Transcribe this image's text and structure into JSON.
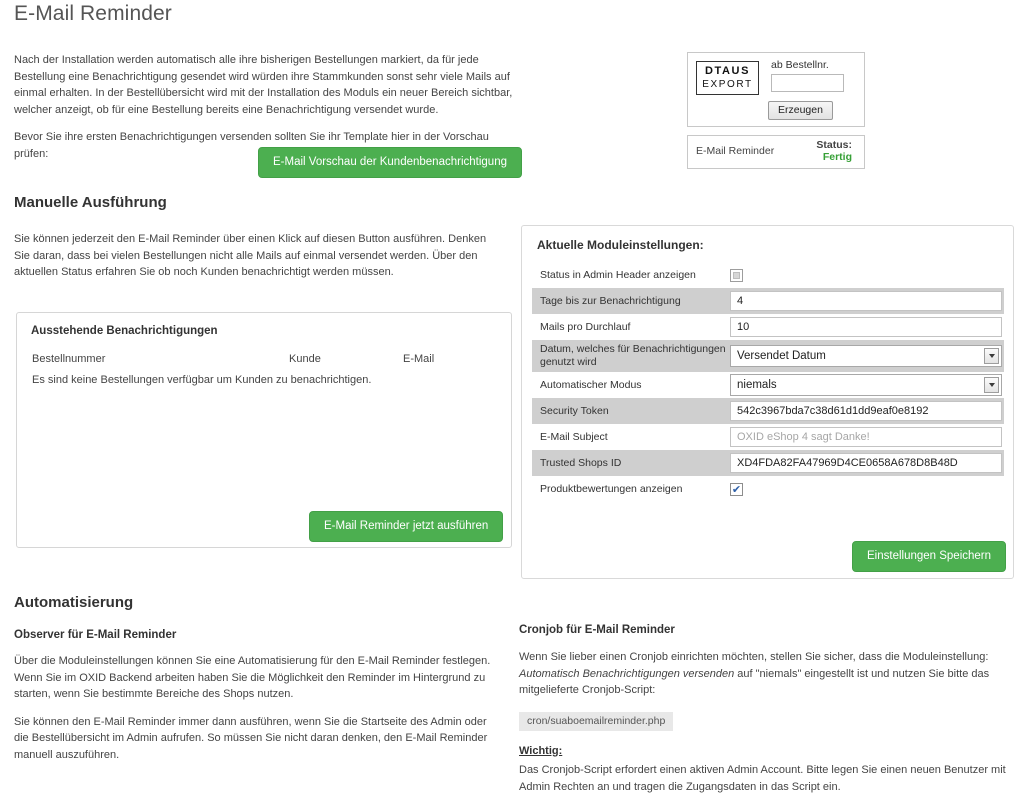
{
  "page": {
    "title": "E-Mail Reminder"
  },
  "intro": {
    "paragraph1": "Nach der Installation werden automatisch alle ihre bisherigen Bestellungen markiert, da für jede Bestellung eine Benachrichtigung gesendet wird würden ihre Stammkunden sonst sehr viele Mails auf einmal erhalten. In der Bestellübersicht wird mit der Installation des Moduls ein neuer Bereich sichtbar, welcher anzeigt, ob für eine Bestellung bereits eine Benachrichtigung versendet wurde.",
    "paragraph2": "Bevor Sie ihre ersten Benachrichtigungen versenden sollten Sie ihr Template hier in der Vorschau prüfen:",
    "preview_button": "E-Mail Vorschau der Kundenbenachrichtigung"
  },
  "dtaus": {
    "logo_line1": "DTAUS",
    "logo_line2": "EXPORT",
    "field_label": "ab Bestellnr.",
    "field_value": "",
    "field_placeholder": "",
    "generate_button": "Erzeugen"
  },
  "status_card": {
    "name": "E-Mail Reminder",
    "status_label": "Status:",
    "status_value": "Fertig",
    "status_color": "#36a036"
  },
  "manual": {
    "heading": "Manuelle Ausführung",
    "description": "Sie können jederzeit den E-Mail Reminder über einen Klick auf diesen Button ausführen. Denken Sie daran, dass bei vielen Bestellungen nicht alle Mails auf einmal versendet werden. Über den aktuellen Status erfahren Sie ob noch Kunden benachrichtigt werden müssen.",
    "run_button": "E-Mail Reminder jetzt ausführen"
  },
  "pending": {
    "title": "Ausstehende Benachrichtigungen",
    "columns": [
      "Bestellnummer",
      "Kunde",
      "E-Mail"
    ],
    "rows": [],
    "empty_message": "Es sind keine Bestellungen verfügbar um Kunden zu benachrichtigen."
  },
  "settings": {
    "title": "Aktuelle Moduleinstellungen:",
    "save_button": "Einstellungen Speichern",
    "rows": [
      {
        "label": "Status in Admin Header anzeigen",
        "type": "checkbox",
        "checked": false
      },
      {
        "label": "Tage bis zur Benachrichtigung",
        "type": "text",
        "value": "4"
      },
      {
        "label": "Mails pro Durchlauf",
        "type": "text",
        "value": "10"
      },
      {
        "label": "Datum, welches für Benachrichtigungen genutzt wird",
        "type": "select",
        "value": "Versendet Datum"
      },
      {
        "label": "Automatischer Modus",
        "type": "select",
        "value": "niemals"
      },
      {
        "label": "Security Token",
        "type": "text",
        "value": "542c3967bda7c38d61d1dd9eaf0e8192"
      },
      {
        "label": "E-Mail Subject",
        "type": "text",
        "value": "",
        "placeholder": "OXID eShop 4 sagt Danke!"
      },
      {
        "label": "Trusted Shops ID",
        "type": "text",
        "value": "XD4FDA82FA47969D4CE0658A678D8B48D"
      },
      {
        "label": "Produktbewertungen anzeigen",
        "type": "checkbox",
        "checked": true
      }
    ]
  },
  "automation": {
    "heading": "Automatisierung",
    "observer_title": "Observer für E-Mail Reminder",
    "observer_p1": "Über die Moduleinstellungen können Sie eine Automatisierung für den E-Mail Reminder festlegen. Wenn Sie im OXID Backend arbeiten haben Sie die Möglichkeit den Reminder im Hintergrund zu starten, wenn Sie bestimmte Bereiche des Shops nutzen.",
    "observer_p2": "Sie können den E-Mail Reminder immer dann ausführen, wenn Sie die Startseite des Admin oder die Bestellübersicht im Admin aufrufen. So müssen Sie nicht daran denken, den E-Mail Reminder manuell auszuführen."
  },
  "cronjob": {
    "title": "Cronjob für E-Mail Reminder",
    "text_before_italic": "Wenn Sie lieber einen Cronjob einrichten möchten, stellen Sie sicher, dass die Moduleinstellung: ",
    "italic_text": "Automatisch Benachrichtigungen versenden",
    "text_after_italic": " auf \"niemals\" eingestellt ist und nutzen Sie bitte das mitgelieferte Cronjob-Script:",
    "script_path": "cron/suaboemailreminder.php",
    "important_label": "Wichtig:",
    "important_text": "Das Cronjob-Script erfordert einen aktiven Admin Account. Bitte legen Sie einen neuen Benutzer mit Admin Rechten an und tragen die Zugangsdaten in das Script ein."
  },
  "colors": {
    "green": "#4caf50",
    "stripe_gray": "#cfcfcf"
  }
}
